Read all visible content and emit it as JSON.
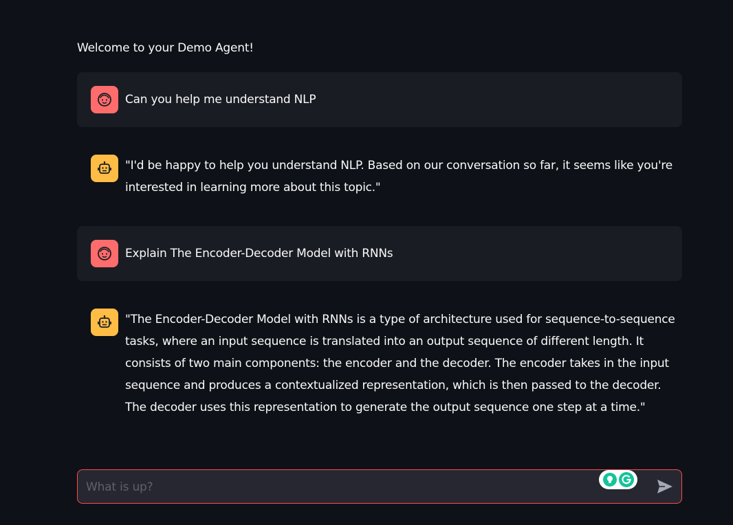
{
  "welcome_text": "Welcome to your Demo Agent!",
  "messages": [
    {
      "role": "user",
      "avatar_icon": "user-face-icon",
      "text": "Can you help me understand NLP"
    },
    {
      "role": "assistant",
      "avatar_icon": "robot-icon",
      "text": "\"I'd be happy to help you understand NLP. Based on our conversation so far, it seems like you're interested in learning more about this topic.\""
    },
    {
      "role": "user",
      "avatar_icon": "user-face-icon",
      "text": "Explain The Encoder-Decoder Model with RNNs"
    },
    {
      "role": "assistant",
      "avatar_icon": "robot-icon",
      "text": "\"The Encoder-Decoder Model with RNNs is a type of architecture used for sequence-to-sequence tasks, where an input sequence is translated into an output sequence of different length. It consists of two main components: the encoder and the decoder. The encoder takes in the input sequence and produces a contextualized representation, which is then passed to the decoder. The decoder uses this representation to generate the output sequence one step at a time.\""
    }
  ],
  "chat_input": {
    "placeholder": "What is up?",
    "value": "",
    "send_icon": "send-arrow-icon"
  },
  "colors": {
    "background": "#0e1117",
    "user_message_bg": "#1a1c24",
    "user_avatar": "#ff6c6c",
    "assistant_avatar": "#ffbd45",
    "input_border": "#ff4b4b",
    "input_bg": "#262730"
  }
}
